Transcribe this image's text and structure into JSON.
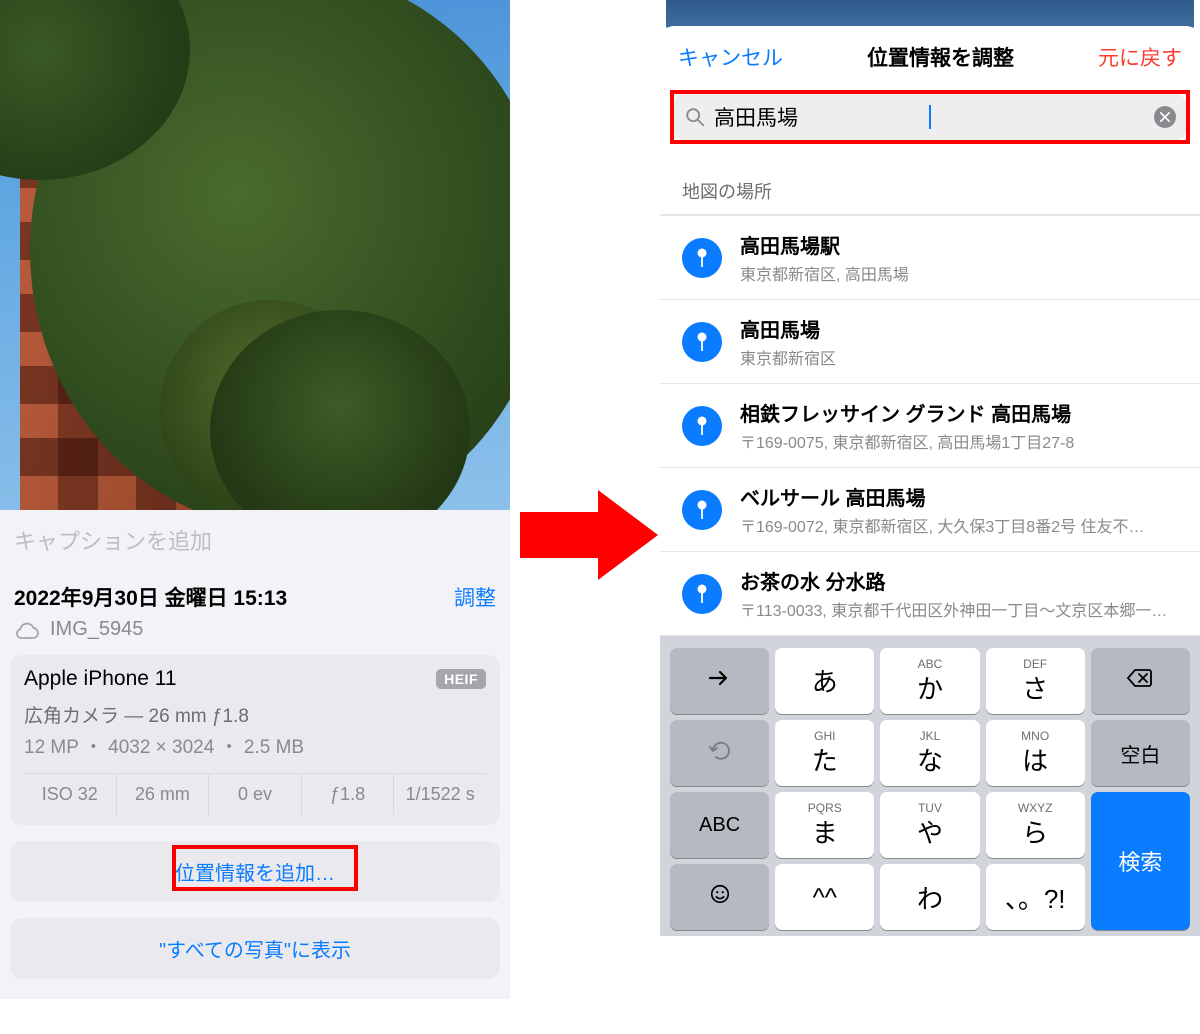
{
  "left": {
    "caption_placeholder": "キャプションを追加",
    "date": "2022年9月30日 金曜日 15:13",
    "adjust": "調整",
    "filename": "IMG_5945",
    "device": "Apple iPhone 11",
    "format_badge": "HEIF",
    "lens": "広角カメラ — 26 mm ƒ1.8",
    "mp_line": "12 MP ・ 4032 × 3024 ・ 2.5 MB",
    "exif": {
      "iso": "ISO 32",
      "focal": "26 mm",
      "ev": "0 ev",
      "aperture": "ƒ1.8",
      "shutter": "1/1522 s"
    },
    "add_location": "位置情報を追加…",
    "show_in_all": "\"すべての写真\"に表示"
  },
  "right": {
    "cancel": "キャンセル",
    "title": "位置情報を調整",
    "revert": "元に戻す",
    "search_value": "高田馬場",
    "section": "地図の場所",
    "results": [
      {
        "name": "高田馬場駅",
        "sub": "東京都新宿区, 高田馬場"
      },
      {
        "name": "高田馬場",
        "sub": "東京都新宿区"
      },
      {
        "name": "相鉄フレッサイン グランド 高田馬場",
        "sub": "〒169-0075, 東京都新宿区, 高田馬場1丁目27-8"
      },
      {
        "name": "ベルサール 高田馬場",
        "sub": "〒169-0072, 東京都新宿区, 大久保3丁目8番2号 住友不…"
      },
      {
        "name": "お茶の水 分水路",
        "sub": "〒113-0033, 東京都千代田区外神田一丁目～文京区本郷一…"
      }
    ],
    "keys": {
      "r1": [
        "あ",
        "か",
        "さ"
      ],
      "r2": [
        "た",
        "な",
        "は"
      ],
      "r3": [
        "ま",
        "や",
        "ら"
      ],
      "r4": [
        "^^",
        "わ",
        "、。?!"
      ],
      "abc": "ABC",
      "space": "空白",
      "search": "検索",
      "small_row1": [
        "",
        "ABC",
        "DEF"
      ],
      "small_row2": [
        "GHI",
        "JKL",
        "MNO"
      ],
      "small_row3": [
        "PQRS",
        "TUV",
        "WXYZ"
      ]
    }
  }
}
